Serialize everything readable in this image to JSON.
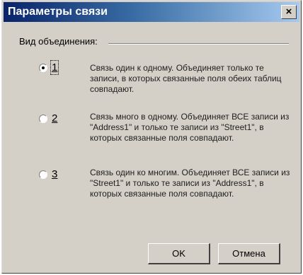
{
  "window": {
    "title": "Параметры связи",
    "close_glyph": "×"
  },
  "group": {
    "label": "Вид объединения:"
  },
  "options": [
    {
      "number": "1",
      "selected": true,
      "text": "Связь один к одному. Объединяет только те записи, в которых связанные поля обеих таблиц совпадают."
    },
    {
      "number": "2",
      "selected": false,
      "text": "Связь много в одному. Объединяет ВСЕ записи из \"Address1\" и только те записи из \"Street1\", в которых связанные поля совпадают."
    },
    {
      "number": "3",
      "selected": false,
      "text": "Связь один ко многим. Объединяет ВСЕ записи из \"Street1\" и только те записи из \"Address1\", в которых связанные поля совпадают."
    }
  ],
  "buttons": {
    "ok": "OK",
    "cancel": "Отмена"
  },
  "icons": {
    "close": "close-icon",
    "radio": "radio-button"
  },
  "colors": {
    "title_start": "#0a246a",
    "title_end": "#a6caf0",
    "face": "#d4d0c8"
  }
}
